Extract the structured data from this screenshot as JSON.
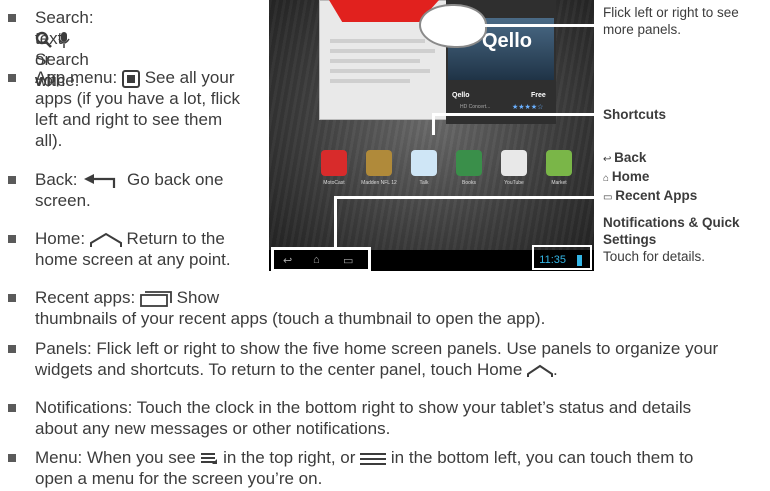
{
  "bullets": {
    "search": {
      "lead": "Search:",
      "rest1": "Search with",
      "rest2": "text or voice."
    },
    "app_menu": {
      "lead": "App menu:",
      "rest1": "See all your",
      "rest2": "apps (if you have a lot, flick",
      "rest3": "left and right to see them",
      "rest4": "all)."
    },
    "back": {
      "lead": "Back:",
      "rest1": "Go back one",
      "rest2": "screen."
    },
    "home": {
      "lead": "Home:",
      "rest1": "Return to the",
      "rest2": "home screen at any point."
    },
    "recent": {
      "lead": "Recent apps:",
      "rest1": "Show",
      "rest2": "thumbnails of your recent apps (touch a thumbnail to open the app)."
    },
    "panels": {
      "line1": "Panels: Flick left or right to show the five home screen panels. Use panels to organize your",
      "line2a": "widgets and shortcuts. To return to the center panel, touch Home",
      "line2b": "."
    },
    "notifications": {
      "line1": "Notifications: Touch the clock in the bottom right to show your tablet’s status and details",
      "line2": "about any new messages or other notifications."
    },
    "menu": {
      "line1a": "Menu: When you see",
      "line1b": "in the top right, or",
      "line1c": "in the bottom left, you can touch them to",
      "line2": "open a menu for the screen you’re on."
    }
  },
  "callouts": {
    "panels": {
      "line1": "Flick left or right to see",
      "line2": "more panels."
    },
    "shortcuts": "Shortcuts",
    "back": "Back",
    "home": "Home",
    "recent_apps": "Recent Apps",
    "notifications_title1": "Notifications & Quick",
    "notifications_title2": "Settings",
    "notifications_desc": "Touch for details."
  },
  "tablet": {
    "qello_logo": "Qello",
    "qello_title": "Qello",
    "qello_price": "Free",
    "qello_sub": "HD Concert...",
    "qello_rating": "★★★★☆",
    "apps": [
      {
        "label": "MotoCast",
        "color": "#d82b2b"
      },
      {
        "label": "Madden NFL 12",
        "color": "#b08a3a"
      },
      {
        "label": "Talk",
        "color": "#cfe6f6"
      },
      {
        "label": "Books",
        "color": "#3a8f4a"
      },
      {
        "label": "YouTube",
        "color": "#e8e8e8"
      },
      {
        "label": "Market",
        "color": "#7ab648"
      }
    ],
    "clock": "11:35"
  }
}
